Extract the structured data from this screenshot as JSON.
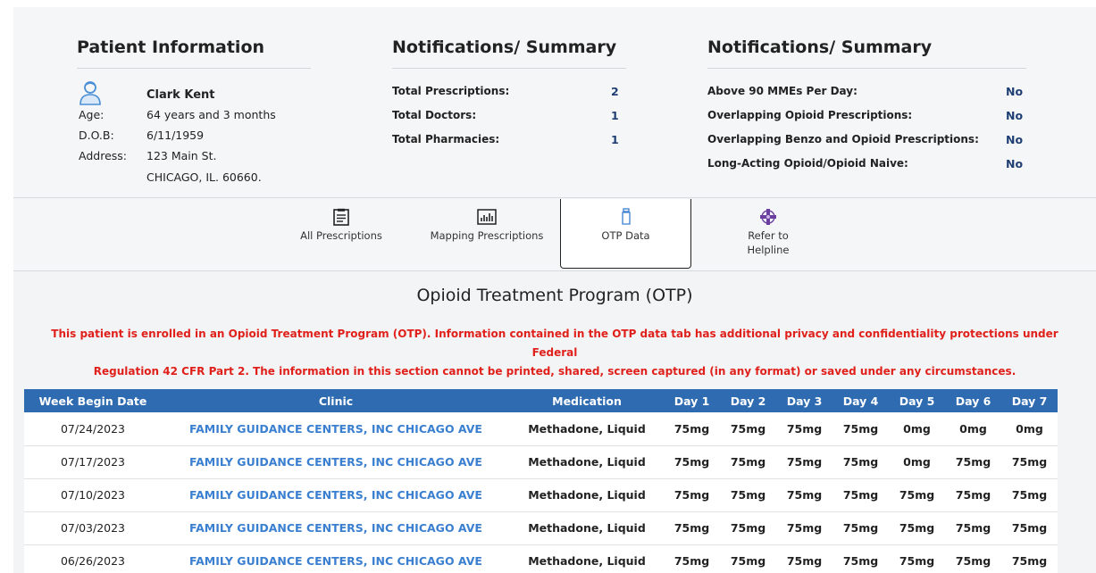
{
  "patient_info": {
    "title": "Patient Information",
    "name": "Clark Kent",
    "age_label": "Age:",
    "age": "64 years and 3 months",
    "dob_label": "D.O.B:",
    "dob": "6/11/1959",
    "address_label": "Address:",
    "address_line1": "123 Main St.",
    "address_line2": "CHICAGO, IL. 60660."
  },
  "summary_counts": {
    "title": "Notifications/ Summary",
    "rows": [
      {
        "label": "Total Prescriptions:",
        "value": "2"
      },
      {
        "label": "Total Doctors:",
        "value": "1"
      },
      {
        "label": "Total Pharmacies:",
        "value": "1"
      }
    ]
  },
  "summary_flags": {
    "title": "Notifications/ Summary",
    "rows": [
      {
        "label": "Above 90 MMEs Per Day:",
        "value": "No"
      },
      {
        "label": "Overlapping Opioid Prescriptions:",
        "value": "No"
      },
      {
        "label": "Overlapping Benzo and Opioid Prescriptions:",
        "value": "No"
      },
      {
        "label": "Long-Acting Opioid/Opioid Naive:",
        "value": "No"
      }
    ]
  },
  "tabs": [
    {
      "label": "All Prescriptions",
      "icon": "clipboard-icon"
    },
    {
      "label": "Mapping Prescriptions",
      "icon": "bar-chart-icon"
    },
    {
      "label": "OTP Data",
      "icon": "bottle-icon",
      "active": true
    },
    {
      "label_line1": "Refer to",
      "label_line2": "Helpline",
      "icon": "helpline-cross-icon"
    }
  ],
  "otp": {
    "title": "Opioid Treatment Program (OTP)",
    "warning_line1": "This patient is enrolled in an Opioid Treatment Program (OTP). Information contained in the OTP data tab has additional privacy and confidentiality protections under Federal",
    "warning_line2": "Regulation 42 CFR Part 2. The information in this section cannot be printed, shared, screen captured (in any format) or saved under any circumstances.",
    "headers": [
      "Week Begin Date",
      "Clinic",
      "Medication",
      "Day 1",
      "Day 2",
      "Day 3",
      "Day 4",
      "Day 5",
      "Day 6",
      "Day 7"
    ],
    "rows": [
      {
        "date": "07/24/2023",
        "clinic": "FAMILY GUIDANCE CENTERS, INC CHICAGO AVE",
        "medication": "Methadone, Liquid",
        "days": [
          "75mg",
          "75mg",
          "75mg",
          "75mg",
          "0mg",
          "0mg",
          "0mg"
        ]
      },
      {
        "date": "07/17/2023",
        "clinic": "FAMILY GUIDANCE CENTERS, INC CHICAGO AVE",
        "medication": "Methadone, Liquid",
        "days": [
          "75mg",
          "75mg",
          "75mg",
          "75mg",
          "0mg",
          "75mg",
          "75mg"
        ]
      },
      {
        "date": "07/10/2023",
        "clinic": "FAMILY GUIDANCE CENTERS, INC CHICAGO AVE",
        "medication": "Methadone, Liquid",
        "days": [
          "75mg",
          "75mg",
          "75mg",
          "75mg",
          "75mg",
          "75mg",
          "75mg"
        ]
      },
      {
        "date": "07/03/2023",
        "clinic": "FAMILY GUIDANCE CENTERS, INC CHICAGO AVE",
        "medication": "Methadone, Liquid",
        "days": [
          "75mg",
          "75mg",
          "75mg",
          "75mg",
          "75mg",
          "75mg",
          "75mg"
        ]
      },
      {
        "date": "06/26/2023",
        "clinic": "FAMILY GUIDANCE CENTERS, INC CHICAGO AVE",
        "medication": "Methadone, Liquid",
        "days": [
          "75mg",
          "75mg",
          "75mg",
          "75mg",
          "75mg",
          "75mg",
          "75mg"
        ]
      }
    ]
  },
  "colors": {
    "header_blue": "#2e6bb0",
    "link_blue": "#3a7fd0",
    "warning_red": "#e0201b",
    "value_navy": "#1f3f74"
  }
}
